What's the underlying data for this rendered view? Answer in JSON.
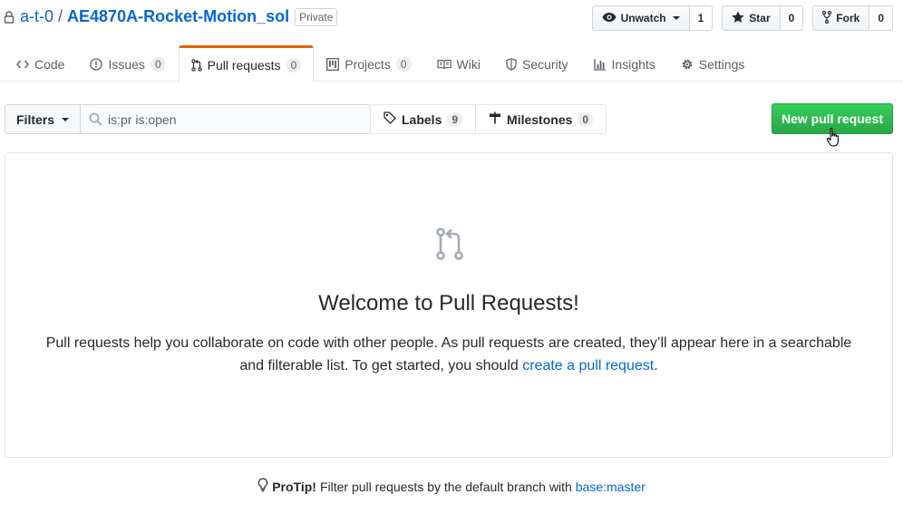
{
  "repo": {
    "owner": "a-t-0",
    "separator": "/",
    "name": "AE4870A-Rocket-Motion_sol",
    "visibility": "Private"
  },
  "actions": {
    "watch": {
      "label": "Unwatch",
      "count": "1"
    },
    "star": {
      "label": "Star",
      "count": "0"
    },
    "fork": {
      "label": "Fork",
      "count": "0"
    }
  },
  "tabs": [
    {
      "label": "Code",
      "icon": "code-icon"
    },
    {
      "label": "Issues",
      "count": "0",
      "icon": "issue-icon"
    },
    {
      "label": "Pull requests",
      "count": "0",
      "icon": "pull-request-icon",
      "selected": true
    },
    {
      "label": "Projects",
      "count": "0",
      "icon": "project-icon"
    },
    {
      "label": "Wiki",
      "icon": "book-icon"
    },
    {
      "label": "Security",
      "icon": "shield-icon"
    },
    {
      "label": "Insights",
      "icon": "graph-icon"
    },
    {
      "label": "Settings",
      "icon": "gear-icon"
    }
  ],
  "filter": {
    "filters_label": "Filters",
    "search_value": "is:pr is:open"
  },
  "labels": {
    "label": "Labels",
    "count": "9"
  },
  "milestones": {
    "label": "Milestones",
    "count": "0"
  },
  "new_pr_label": "New pull request",
  "blankslate": {
    "title": "Welcome to Pull Requests!",
    "text_before": "Pull requests help you collaborate on code with other people. As pull requests are created, they’ll appear here in a searchable and filterable list. To get started, you should ",
    "link": "create a pull request",
    "text_after": "."
  },
  "protip": {
    "lead": "ProTip!",
    "text": "Filter pull requests by the default branch with",
    "link": "base:master"
  },
  "colors": {
    "link": "#0366d6",
    "primary_button": "#28a745",
    "selected_tab_accent": "#e36209"
  }
}
